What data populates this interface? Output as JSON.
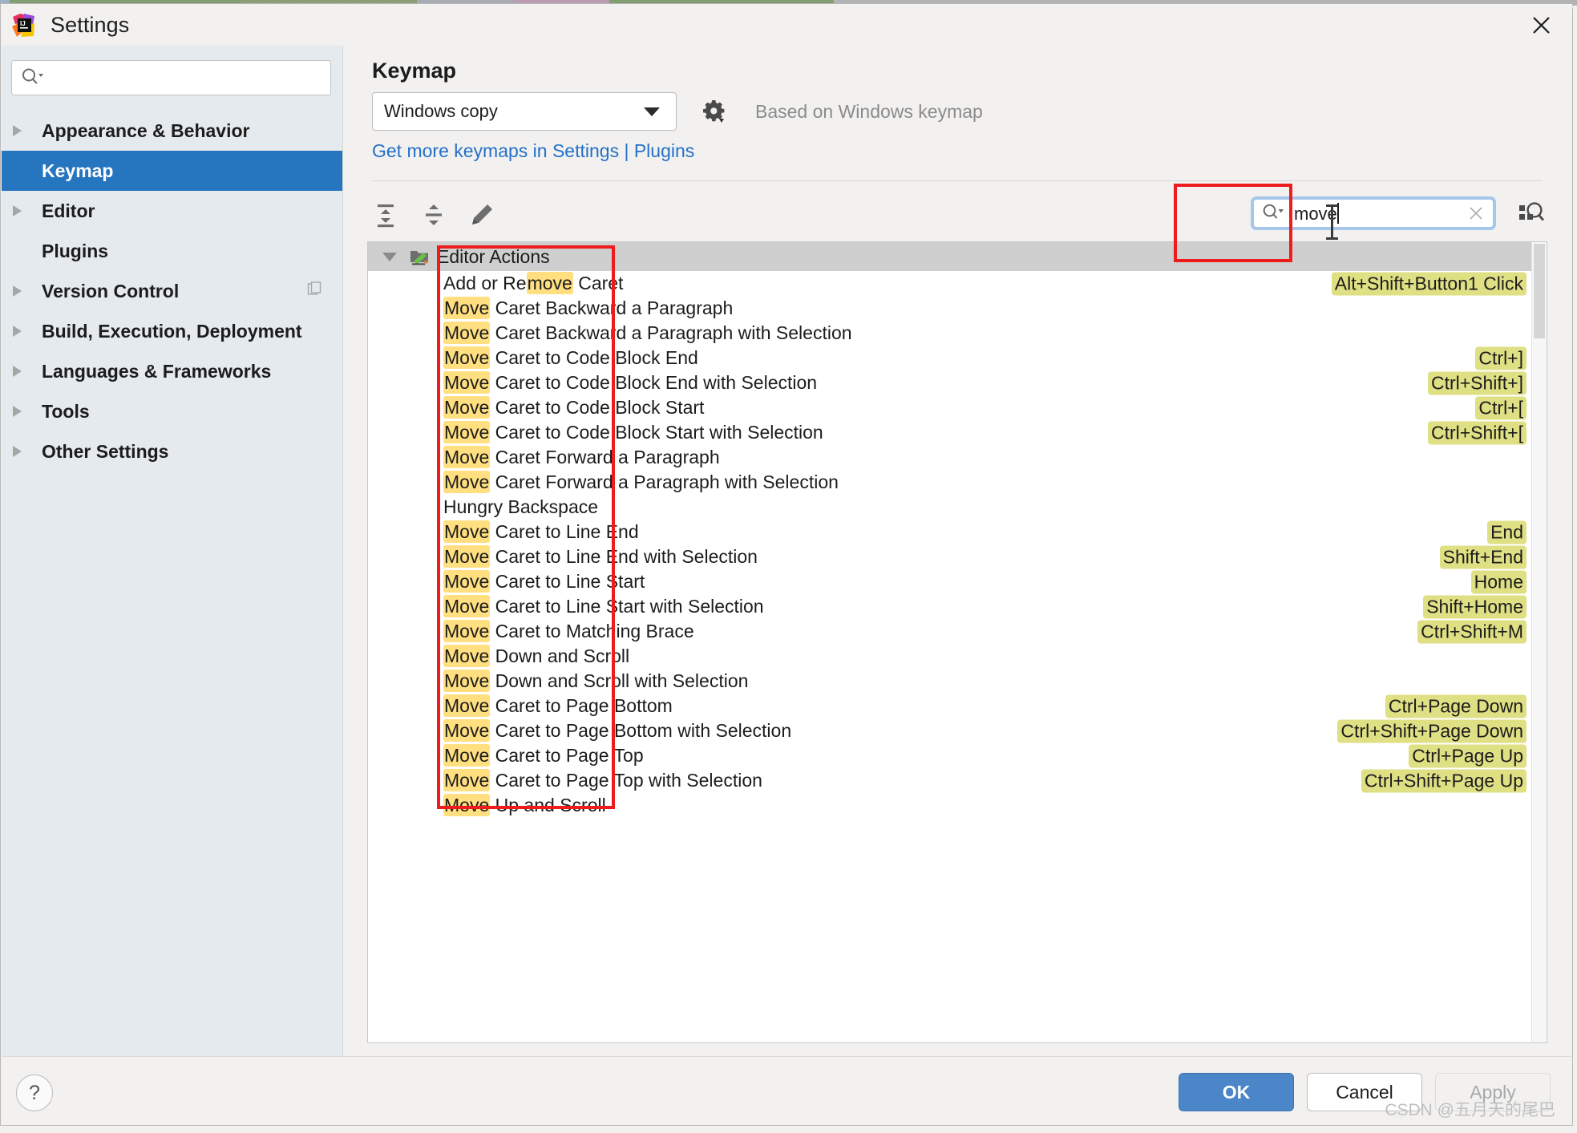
{
  "window": {
    "title": "Settings",
    "close_label": "✕",
    "logo_name": "intellij-idea-logo"
  },
  "sidebar": {
    "search_placeholder": "",
    "search_value": "",
    "items": [
      {
        "label": "Appearance & Behavior",
        "expandable": true,
        "selected": false
      },
      {
        "label": "Keymap",
        "expandable": false,
        "selected": true
      },
      {
        "label": "Editor",
        "expandable": true,
        "selected": false
      },
      {
        "label": "Plugins",
        "expandable": false,
        "selected": false
      },
      {
        "label": "Version Control",
        "expandable": true,
        "selected": false,
        "badge": "copy-icon"
      },
      {
        "label": "Build, Execution, Deployment",
        "expandable": true,
        "selected": false
      },
      {
        "label": "Languages & Frameworks",
        "expandable": true,
        "selected": false
      },
      {
        "label": "Tools",
        "expandable": true,
        "selected": false
      },
      {
        "label": "Other Settings",
        "expandable": true,
        "selected": false
      }
    ]
  },
  "main": {
    "title": "Keymap",
    "keymap_selected": "Windows copy",
    "based_on": "Based on Windows keymap",
    "plugins_link": "Get more keymaps in Settings | Plugins",
    "toolbar": {
      "expand_all": "Expand All",
      "collapse_all": "Collapse All",
      "edit": "Edit Shortcut"
    },
    "search": {
      "value": "move",
      "clear_label": "✕",
      "find_by_shortcut": "Find Actions by Shortcut"
    },
    "group": {
      "label": "Editor Actions",
      "expanded": true
    },
    "actions": [
      {
        "pre": "Add or Re",
        "match": "move",
        "post": " Caret",
        "shortcut": "Alt+Shift+Button1 Click"
      },
      {
        "pre": "",
        "match": "Move",
        "post": " Caret Backward a Paragraph",
        "shortcut": ""
      },
      {
        "pre": "",
        "match": "Move",
        "post": " Caret Backward a Paragraph with Selection",
        "shortcut": ""
      },
      {
        "pre": "",
        "match": "Move",
        "post": " Caret to Code Block End",
        "shortcut": "Ctrl+]"
      },
      {
        "pre": "",
        "match": "Move",
        "post": " Caret to Code Block End with Selection",
        "shortcut": "Ctrl+Shift+]"
      },
      {
        "pre": "",
        "match": "Move",
        "post": " Caret to Code Block Start",
        "shortcut": "Ctrl+["
      },
      {
        "pre": "",
        "match": "Move",
        "post": " Caret to Code Block Start with Selection",
        "shortcut": "Ctrl+Shift+["
      },
      {
        "pre": "",
        "match": "Move",
        "post": " Caret Forward a Paragraph",
        "shortcut": ""
      },
      {
        "pre": "",
        "match": "Move",
        "post": " Caret Forward a Paragraph with Selection",
        "shortcut": ""
      },
      {
        "pre": "Hungry Backspace",
        "match": "",
        "post": "",
        "shortcut": ""
      },
      {
        "pre": "",
        "match": "Move",
        "post": " Caret to Line End",
        "shortcut": "End"
      },
      {
        "pre": "",
        "match": "Move",
        "post": " Caret to Line End with Selection",
        "shortcut": "Shift+End"
      },
      {
        "pre": "",
        "match": "Move",
        "post": " Caret to Line Start",
        "shortcut": "Home"
      },
      {
        "pre": "",
        "match": "Move",
        "post": " Caret to Line Start with Selection",
        "shortcut": "Shift+Home"
      },
      {
        "pre": "",
        "match": "Move",
        "post": " Caret to Matching Brace",
        "shortcut": "Ctrl+Shift+M"
      },
      {
        "pre": "",
        "match": "Move",
        "post": " Down and Scroll",
        "shortcut": ""
      },
      {
        "pre": "",
        "match": "Move",
        "post": " Down and Scroll with Selection",
        "shortcut": ""
      },
      {
        "pre": "",
        "match": "Move",
        "post": " Caret to Page Bottom",
        "shortcut": "Ctrl+Page Down"
      },
      {
        "pre": "",
        "match": "Move",
        "post": " Caret to Page Bottom with Selection",
        "shortcut": "Ctrl+Shift+Page Down"
      },
      {
        "pre": "",
        "match": "Move",
        "post": " Caret to Page Top",
        "shortcut": "Ctrl+Page Up"
      },
      {
        "pre": "",
        "match": "Move",
        "post": " Caret to Page Top with Selection",
        "shortcut": "Ctrl+Shift+Page Up"
      },
      {
        "pre": "",
        "match": "Move",
        "post": " Up and Scroll",
        "shortcut": ""
      }
    ]
  },
  "footer": {
    "help_label": "?",
    "ok_label": "OK",
    "cancel_label": "Cancel",
    "apply_label": "Apply"
  },
  "watermark": "CSDN @五月天的尾巴",
  "colors": {
    "selection_blue": "#2675bf",
    "primary_button": "#4a86c8",
    "match_highlight": "#ffdf80",
    "shortcut_highlight": "#dfdf84",
    "link": "#2470c7",
    "annotation_red": "#ee1c1c"
  }
}
